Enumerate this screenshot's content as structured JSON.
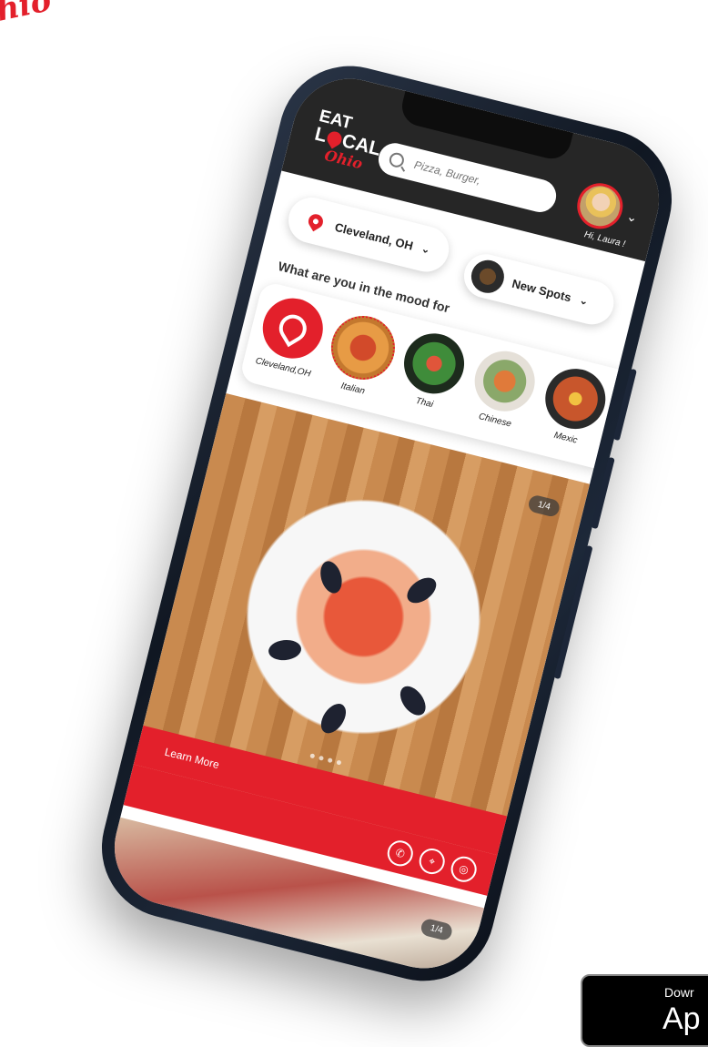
{
  "brand": {
    "corner_script": "hio",
    "logo_line1": "EAT",
    "logo_line2_left": "L",
    "logo_line2_right": "CAL",
    "logo_line3": "Ohio"
  },
  "header": {
    "search_placeholder": "Pizza, Burger,",
    "greeting": "Hi, Laura !"
  },
  "location": {
    "city": "Cleveland, OH",
    "spots_label": "New Spots"
  },
  "mood": {
    "title": "What are you in the mood for",
    "categories": [
      {
        "label": "Cleveland,OH"
      },
      {
        "label": "Italian"
      },
      {
        "label": "Thai"
      },
      {
        "label": "Chinese"
      },
      {
        "label": "Mexic"
      }
    ]
  },
  "feed": {
    "card1_page": "1/4",
    "learn_more": "Learn More",
    "card2_page": "1/4"
  },
  "appstore": {
    "line1": "Dowr",
    "line2": "Ap"
  },
  "colors": {
    "accent": "#e3202b",
    "header_bg": "#262626"
  }
}
